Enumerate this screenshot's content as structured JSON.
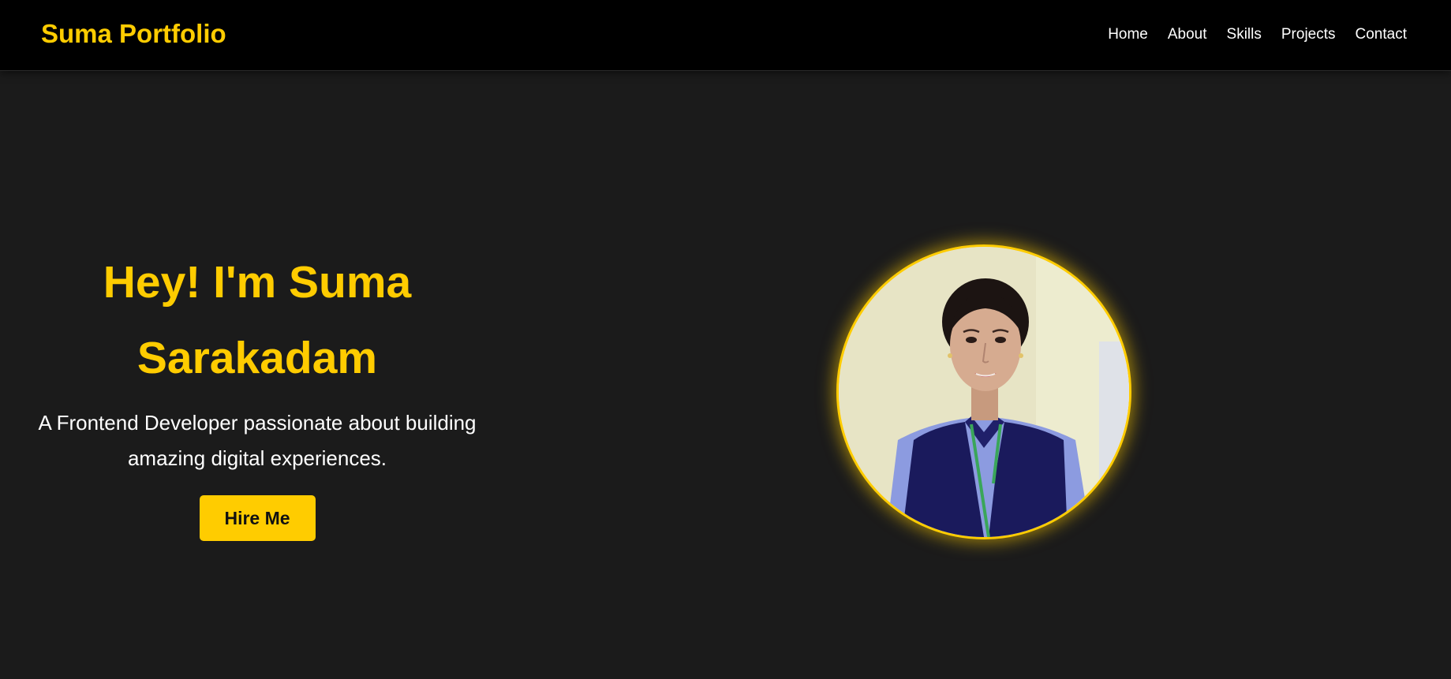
{
  "header": {
    "brand": "Suma Portfolio",
    "nav": [
      {
        "label": "Home"
      },
      {
        "label": "About"
      },
      {
        "label": "Skills"
      },
      {
        "label": "Projects"
      },
      {
        "label": "Contact"
      }
    ]
  },
  "hero": {
    "title_line1": "Hey! I'm Suma",
    "title_line2": "Sarakadam",
    "subtitle_line1": "A Frontend Developer passionate about building",
    "subtitle_line2": "amazing digital experiences.",
    "cta_label": "Hire Me",
    "profile_alt": "profile photo"
  },
  "colors": {
    "accent": "#ffcc00",
    "background": "#1b1b1b",
    "navbar": "#000000",
    "text": "#ffffff"
  }
}
